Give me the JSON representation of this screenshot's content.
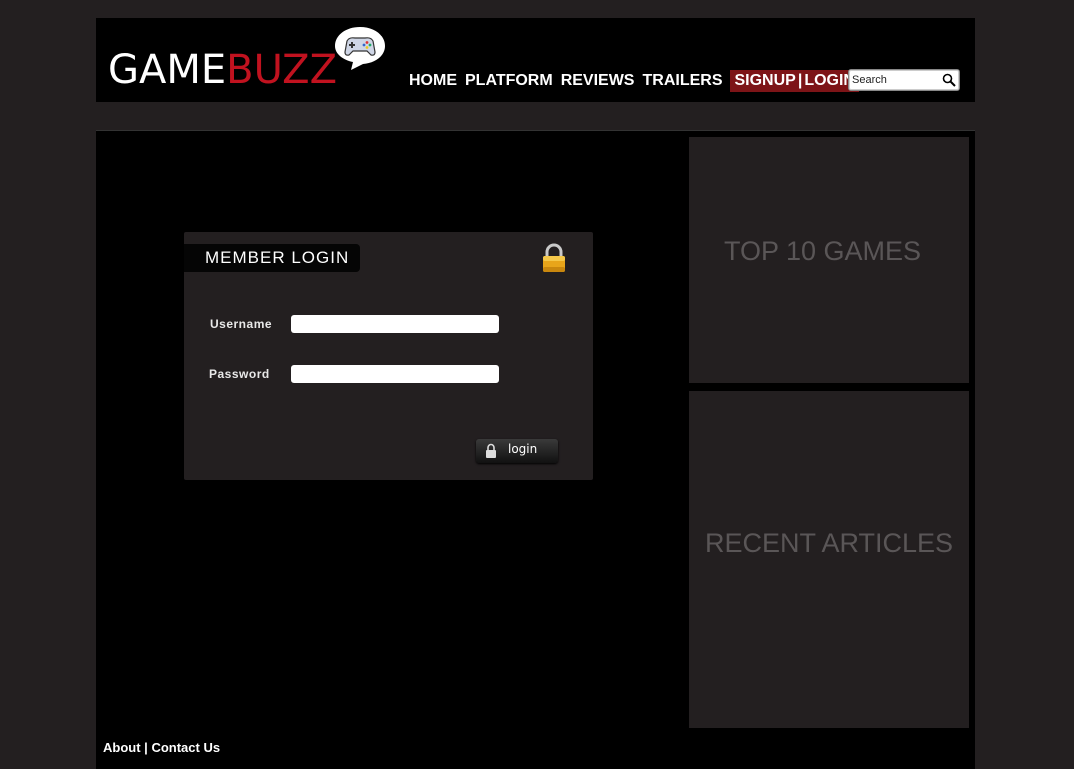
{
  "brand": {
    "name_part1": "GAME",
    "name_part2": "BUZZ",
    "icon": "gamepad-speech-bubble-icon",
    "accent_color": "#c1121f"
  },
  "nav": {
    "items": [
      "HOME",
      "PLATFORM",
      "REVIEWS",
      "TRAILERS"
    ],
    "signup_label": "SIGNUP",
    "separator": "|",
    "login_label": "LOGIN",
    "auth_bg_color": "#7d1417"
  },
  "search": {
    "placeholder": "Search",
    "icon": "magnifier-icon"
  },
  "login_panel": {
    "title": "MEMBER LOGIN",
    "icon": "padlock-icon",
    "username_label": "Username",
    "username_value": "",
    "password_label": "Password",
    "password_value": "",
    "button_label": "login"
  },
  "sidebar": {
    "top_games_title": "TOP 10 GAMES",
    "recent_articles_title": "RECENT ARTICLES"
  },
  "footer": {
    "about_label": "About",
    "separator": "|",
    "contact_label": "Contact Us"
  }
}
